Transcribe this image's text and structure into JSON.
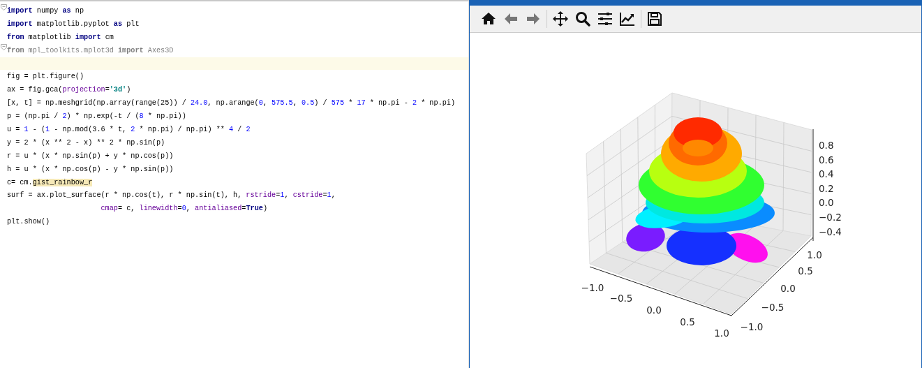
{
  "editor": {
    "lines": [
      {
        "fold": true,
        "current": false,
        "unused": false,
        "tokens": [
          {
            "kind": "keyword",
            "text": "import"
          },
          {
            "kind": "plain",
            "text": " numpy "
          },
          {
            "kind": "keyword",
            "text": "as"
          },
          {
            "kind": "plain",
            "text": " np"
          }
        ]
      },
      {
        "fold": false,
        "current": false,
        "unused": false,
        "tokens": [
          {
            "kind": "keyword",
            "text": "import"
          },
          {
            "kind": "plain",
            "text": " matplotlib.pyplot "
          },
          {
            "kind": "keyword",
            "text": "as"
          },
          {
            "kind": "plain",
            "text": " plt"
          }
        ]
      },
      {
        "fold": false,
        "current": false,
        "unused": false,
        "tokens": [
          {
            "kind": "keyword",
            "text": "from"
          },
          {
            "kind": "plain",
            "text": " matplotlib "
          },
          {
            "kind": "keyword",
            "text": "import"
          },
          {
            "kind": "plain",
            "text": " cm"
          }
        ]
      },
      {
        "fold": true,
        "current": false,
        "unused": true,
        "tokens": [
          {
            "kind": "keyword",
            "text": "from"
          },
          {
            "kind": "plain",
            "text": " mpl_toolkits.mplot3d "
          },
          {
            "kind": "keyword",
            "text": "import"
          },
          {
            "kind": "plain",
            "text": " Axes3D"
          }
        ]
      },
      {
        "fold": false,
        "current": true,
        "unused": false
      },
      {
        "fold": false,
        "current": false,
        "unused": false,
        "tokens": [
          {
            "kind": "plain",
            "text": "fig = plt.figure()"
          }
        ]
      },
      {
        "fold": false,
        "current": false,
        "unused": false,
        "tokens": [
          {
            "kind": "plain",
            "text": "ax = fig.gca("
          },
          {
            "kind": "kwarg",
            "text": "projection"
          },
          {
            "kind": "plain",
            "text": "="
          },
          {
            "kind": "string",
            "text": "'3d'"
          },
          {
            "kind": "plain",
            "text": ")"
          }
        ]
      },
      {
        "fold": false,
        "current": false,
        "unused": false,
        "tokens": [
          {
            "kind": "plain",
            "text": "[x, t] = np.meshgrid(np.array(range(25)) / "
          },
          {
            "kind": "number",
            "text": "24.0"
          },
          {
            "kind": "plain",
            "text": ", np.arange("
          },
          {
            "kind": "number",
            "text": "0"
          },
          {
            "kind": "plain",
            "text": ", "
          },
          {
            "kind": "number",
            "text": "575.5"
          },
          {
            "kind": "plain",
            "text": ", "
          },
          {
            "kind": "number",
            "text": "0.5"
          },
          {
            "kind": "plain",
            "text": ") / "
          },
          {
            "kind": "number",
            "text": "575"
          },
          {
            "kind": "plain",
            "text": " * "
          },
          {
            "kind": "number",
            "text": "17"
          },
          {
            "kind": "plain",
            "text": " * np.pi - "
          },
          {
            "kind": "number",
            "text": "2"
          },
          {
            "kind": "plain",
            "text": " * np.pi)"
          }
        ]
      },
      {
        "fold": false,
        "current": false,
        "unused": false,
        "tokens": [
          {
            "kind": "plain",
            "text": "p = (np.pi / "
          },
          {
            "kind": "number",
            "text": "2"
          },
          {
            "kind": "plain",
            "text": ") * np.exp(-t / ("
          },
          {
            "kind": "number",
            "text": "8"
          },
          {
            "kind": "plain",
            "text": " * np.pi))"
          }
        ]
      },
      {
        "fold": false,
        "current": false,
        "unused": false,
        "tokens": [
          {
            "kind": "plain",
            "text": "u = "
          },
          {
            "kind": "number",
            "text": "1"
          },
          {
            "kind": "plain",
            "text": " - ("
          },
          {
            "kind": "number",
            "text": "1"
          },
          {
            "kind": "plain",
            "text": " - np.mod(3.6 * t, "
          },
          {
            "kind": "number",
            "text": "2"
          },
          {
            "kind": "plain",
            "text": " * np.pi) / np.pi) ** "
          },
          {
            "kind": "number",
            "text": "4"
          },
          {
            "kind": "plain",
            "text": " / "
          },
          {
            "kind": "number",
            "text": "2"
          }
        ]
      },
      {
        "fold": false,
        "current": false,
        "unused": false,
        "tokens": [
          {
            "kind": "plain",
            "text": "y = 2 * (x ** 2 - x) ** 2 * np.sin(p)"
          }
        ]
      },
      {
        "fold": false,
        "current": false,
        "unused": false,
        "tokens": [
          {
            "kind": "plain",
            "text": "r = u * (x * np.sin(p) + y * np.cos(p))"
          }
        ]
      },
      {
        "fold": false,
        "current": false,
        "unused": false,
        "tokens": [
          {
            "kind": "plain",
            "text": "h = u * (x * np.cos(p) - y * np.sin(p))"
          }
        ]
      },
      {
        "fold": false,
        "current": false,
        "unused": false,
        "tokens": [
          {
            "kind": "plain",
            "text": "c= cm."
          },
          {
            "kind": "highlight",
            "text": "gist_rainbow_r"
          }
        ]
      },
      {
        "fold": false,
        "current": false,
        "unused": false,
        "tokens": [
          {
            "kind": "plain",
            "text": "surf = ax.plot_surface(r * np.cos(t), r * np.sin(t), h, "
          },
          {
            "kind": "kwarg",
            "text": "rstride"
          },
          {
            "kind": "plain",
            "text": "="
          },
          {
            "kind": "number",
            "text": "1"
          },
          {
            "kind": "plain",
            "text": ", "
          },
          {
            "kind": "kwarg",
            "text": "cstride"
          },
          {
            "kind": "plain",
            "text": "="
          },
          {
            "kind": "number",
            "text": "1"
          },
          {
            "kind": "plain",
            "text": ","
          }
        ]
      },
      {
        "fold": false,
        "current": false,
        "unused": false,
        "tokens": [
          {
            "kind": "kwarg",
            "text": "                      cmap"
          },
          {
            "kind": "plain",
            "text": "= c, "
          },
          {
            "kind": "kwarg",
            "text": "linewidth"
          },
          {
            "kind": "plain",
            "text": "="
          },
          {
            "kind": "number",
            "text": "0"
          },
          {
            "kind": "plain",
            "text": ", "
          },
          {
            "kind": "kwarg",
            "text": "antialiased"
          },
          {
            "kind": "plain",
            "text": "="
          },
          {
            "kind": "keyword",
            "text": "True"
          },
          {
            "kind": "plain",
            "text": ")"
          }
        ]
      },
      {
        "fold": false,
        "current": false,
        "unused": false,
        "tokens": [
          {
            "kind": "plain",
            "text": "plt.show()"
          }
        ]
      }
    ]
  },
  "figure": {
    "toolbar": [
      {
        "kind": "home"
      },
      {
        "kind": "back"
      },
      {
        "kind": "forward"
      },
      {
        "kind": "separator"
      },
      {
        "kind": "pan"
      },
      {
        "kind": "zoom"
      },
      {
        "kind": "configure"
      },
      {
        "kind": "edit"
      },
      {
        "kind": "separator"
      },
      {
        "kind": "save"
      }
    ],
    "plot": {
      "x_ticks": [
        "−1.0",
        "−0.5",
        "0.0",
        "0.5",
        "1.0"
      ],
      "y_ticks": [
        "−1.0",
        "−0.5",
        "0.0",
        "0.5",
        "1.0"
      ],
      "z_ticks": [
        "0.8",
        "0.6",
        "0.4",
        "0.2",
        "0.0",
        "−0.2",
        "−0.4"
      ]
    }
  }
}
